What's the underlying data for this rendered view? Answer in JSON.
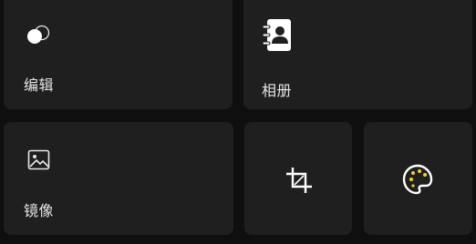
{
  "tiles": {
    "edit": {
      "label": "编辑",
      "icon": "overlapping-circles-icon"
    },
    "album": {
      "label": "相册",
      "icon": "contact-book-icon"
    },
    "mirror": {
      "label": "镜像",
      "icon": "image-icon"
    },
    "crop": {
      "label": "",
      "icon": "crop-icon"
    },
    "palette": {
      "label": "",
      "icon": "palette-icon"
    }
  },
  "colors": {
    "background": "#0f0f0f",
    "tile": "#1f1f1f",
    "text": "#e6e6e6",
    "accent": "#f2d024"
  }
}
